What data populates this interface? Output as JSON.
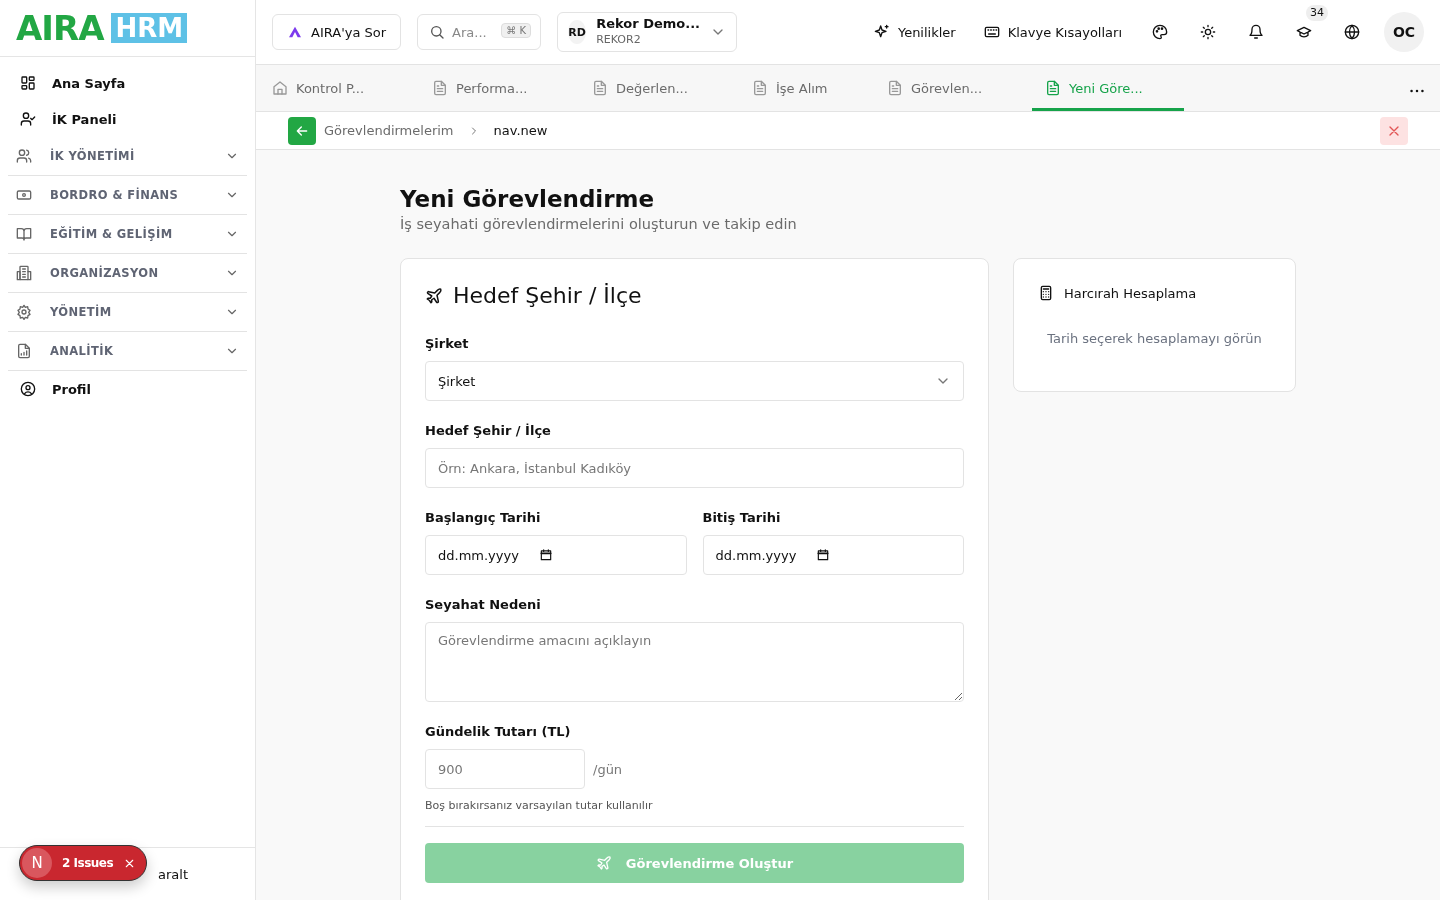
{
  "logo": {
    "word": "AIRA",
    "badge": "HRM"
  },
  "sidebar": {
    "items": [
      {
        "label": "Ana Sayfa",
        "kind": "link"
      },
      {
        "label": "İK Paneli",
        "kind": "link"
      },
      {
        "label": "İK YÖNETİMİ",
        "kind": "group",
        "expanded": false
      },
      {
        "label": "BORDRO & FİNANS",
        "kind": "group",
        "expanded": false
      },
      {
        "label": "EĞİTİM & GELİŞİM",
        "kind": "group",
        "expanded": false
      },
      {
        "label": "ORGANİZASYON",
        "kind": "group",
        "expanded": false
      },
      {
        "label": "YÖNETİM",
        "kind": "group",
        "expanded": false
      },
      {
        "label": "ANALİTİK",
        "kind": "group",
        "expanded": false
      },
      {
        "label": "Profil",
        "kind": "link"
      }
    ],
    "footer": "aralt"
  },
  "topbar": {
    "ask": "AIRA'ya Sor",
    "search": {
      "placeholder": "Ara...",
      "shortcut": "⌘ K"
    },
    "company": {
      "initials": "RD",
      "name": "Rekor Demo...",
      "code": "REKOR2"
    },
    "whats_new": "Yenilikler",
    "shortcuts": "Klavye Kısayolları",
    "learning_badge": "34",
    "avatar": "OC"
  },
  "tabs": [
    {
      "label": "Kontrol P...",
      "selected": false
    },
    {
      "label": "Performa...",
      "selected": false
    },
    {
      "label": "Değerlen...",
      "selected": false
    },
    {
      "label": "İşe Alım",
      "selected": false
    },
    {
      "label": "Görevlen...",
      "selected": false
    },
    {
      "label": "Yeni Göre...",
      "selected": true
    }
  ],
  "breadcrumb": [
    "Görevlendirmelerim",
    "nav.new"
  ],
  "page": {
    "title": "Yeni Görevlendirme",
    "subtitle": "İş seyahati görevlendirmelerini oluşturun ve takip edin"
  },
  "form": {
    "title": "Hedef Şehir / İlçe",
    "company": {
      "label": "Şirket",
      "value": "Şirket"
    },
    "city": {
      "label": "Hedef Şehir / İlçe",
      "placeholder": "Örn: Ankara, İstanbul Kadıköy"
    },
    "start": {
      "label": "Başlangıç Tarihi",
      "value": "dd.mm.yyyy"
    },
    "end": {
      "label": "Bitiş Tarihi",
      "value": "dd.mm.yyyy"
    },
    "reason": {
      "label": "Seyahat Nedeni",
      "placeholder": "Görevlendirme amacını açıklayın"
    },
    "daily": {
      "label": "Gündelik Tutarı (TL)",
      "placeholder": "900",
      "unit": "/gün",
      "hint": "Boş bırakırsanız varsayılan tutar kullanılır"
    },
    "submit": {
      "label": "Görevlendirme Oluştur",
      "disabled": true
    }
  },
  "calc": {
    "title": "Harcırah Hesaplama",
    "empty": "Tarih seçerek hesaplamayı görün"
  },
  "issues": {
    "letter": "N",
    "label": "2 Issues"
  }
}
